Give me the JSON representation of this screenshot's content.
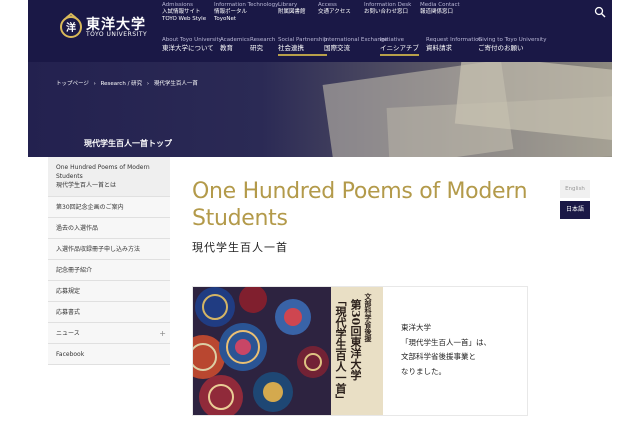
{
  "header": {
    "logo_jp": "東洋大学",
    "logo_en": "TOYO UNIVERSITY",
    "utility_links": [
      {
        "en": "Admissions",
        "jp": "入試情報サイト",
        "extra": "TOYO Web Style"
      },
      {
        "en": "Information Technology",
        "jp": "情報ポータル",
        "extra": "ToyoNet"
      },
      {
        "en": "Library",
        "jp": "附属図書館",
        "extra": ""
      },
      {
        "en": "Access",
        "jp": "交通アクセス",
        "extra": ""
      },
      {
        "en": "Information Desk",
        "jp": "お問い合わせ窓口",
        "extra": ""
      },
      {
        "en": "Media Contact",
        "jp": "報道関係窓口",
        "extra": ""
      }
    ],
    "nav": [
      {
        "en": "About Toyo University",
        "jp": "東洋大学について"
      },
      {
        "en": "Academics",
        "jp": "教育"
      },
      {
        "en": "Research",
        "jp": "研究"
      },
      {
        "en": "Social Partnership",
        "jp": "社会連携"
      },
      {
        "en": "International Exchange",
        "jp": "国際交流"
      },
      {
        "en": "Initiative",
        "jp": "イニシアチブ"
      },
      {
        "en": "Request Information",
        "jp": "資料請求"
      },
      {
        "en": "Giving to Toyo University",
        "jp": "ご寄付のお願い"
      }
    ]
  },
  "breadcrumb": [
    "トップページ",
    "›",
    "Research / 研究",
    "›",
    "現代学生百人一首"
  ],
  "section_title": "現代学生百人一首トップ",
  "sidebar": [
    {
      "label": "One Hundred Poems of Modern Students",
      "label2": "現代学生百人一首とは"
    },
    {
      "label": "第30回記念企画のご案内"
    },
    {
      "label": "過去の入選作品"
    },
    {
      "label": "入選作品収録冊子申し込み方法"
    },
    {
      "label": "記念冊子紹介"
    },
    {
      "label": "応募規定"
    },
    {
      "label": "応募書式"
    },
    {
      "label": "ニュース",
      "plus": "+"
    },
    {
      "label": "Facebook"
    }
  ],
  "main": {
    "title": "One Hundred Poems of Modern Students",
    "subtitle": "現代学生百人一首"
  },
  "language": {
    "english": "English",
    "japanese": "日本語"
  },
  "banner": {
    "vertical_small": "文部科学省後援",
    "vertical_main_1": "第30回東洋大学",
    "vertical_main_2": "「現代学生百人一首」",
    "lines": [
      "東洋大学",
      "「現代学生百人一首」は、",
      "文部科学省後援事業と",
      "なりました。"
    ]
  },
  "colors": {
    "navy": "#1a1846",
    "gold": "#b39a4a"
  }
}
